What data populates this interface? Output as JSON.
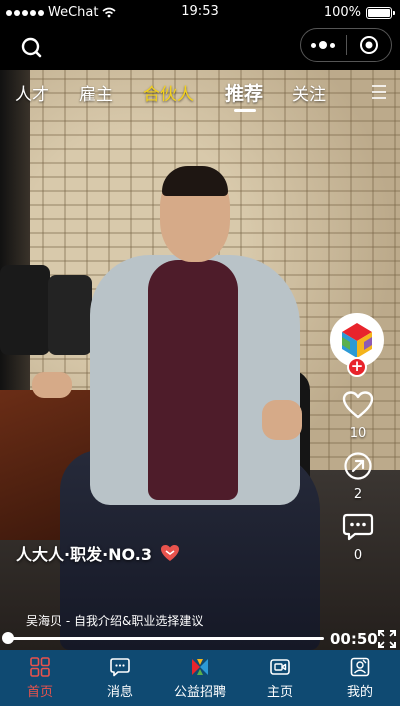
{
  "status": {
    "carrier": "WeChat",
    "time": "19:53",
    "battery": "100%",
    "battery_level": 1.0
  },
  "tabs": [
    {
      "label": "人才",
      "style": "normal"
    },
    {
      "label": "雇主",
      "style": "normal"
    },
    {
      "label": "合伙人",
      "style": "gold"
    },
    {
      "label": "推荐",
      "style": "active"
    },
    {
      "label": "关注",
      "style": "normal"
    }
  ],
  "actions": {
    "likes": "10",
    "shares": "2",
    "comments": "0"
  },
  "video": {
    "channel_title": "人大人·职发·NO.3",
    "caption": "吴海贝 - 自我介绍&职业选择建议",
    "duration": "00:50",
    "progress": 0.0
  },
  "nav": [
    {
      "label": "首页",
      "icon": "home-grid-icon",
      "active": true
    },
    {
      "label": "消息",
      "icon": "message-icon",
      "active": false
    },
    {
      "label": "公益招聘",
      "icon": "charity-logo-icon",
      "active": false
    },
    {
      "label": "主页",
      "icon": "video-profile-icon",
      "active": false
    },
    {
      "label": "我的",
      "icon": "user-card-icon",
      "active": false
    }
  ],
  "colors": {
    "nav_bg": "#0f4a72",
    "active_nav": "#e8534d",
    "gold_tab": "#f4d21c",
    "follow_red": "#e8242c"
  }
}
